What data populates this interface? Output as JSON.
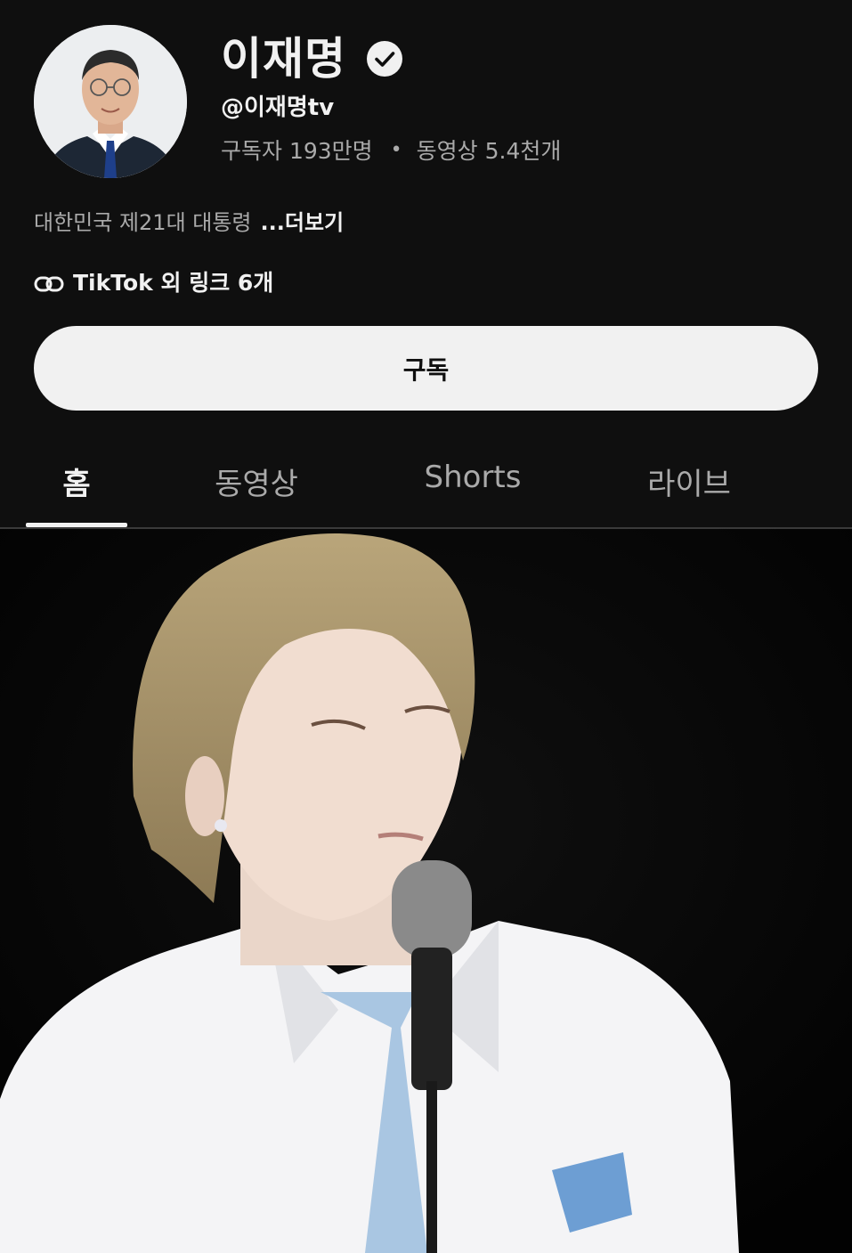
{
  "channel": {
    "name": "이재명",
    "handle": "@이재명tv",
    "subscribers": "구독자 193만명",
    "separator": "•",
    "videos": "동영상 5.4천개",
    "description": "대한민국 제21대 대통령",
    "more_label": "...더보기",
    "links_label": "TikTok 외 링크 6개"
  },
  "subscribe_button": {
    "label": "구독"
  },
  "tabs": [
    {
      "label": "홈",
      "active": true
    },
    {
      "label": "동영상",
      "active": false
    },
    {
      "label": "Shorts",
      "active": false
    },
    {
      "label": "라이브",
      "active": false
    }
  ],
  "icons": {
    "verified": "verified-check-icon",
    "link": "link-icon"
  },
  "colors": {
    "background": "#0f0f0f",
    "text_primary": "#f1f1f1",
    "text_secondary": "#aaaaaa",
    "button_bg": "#f1f1f1"
  }
}
